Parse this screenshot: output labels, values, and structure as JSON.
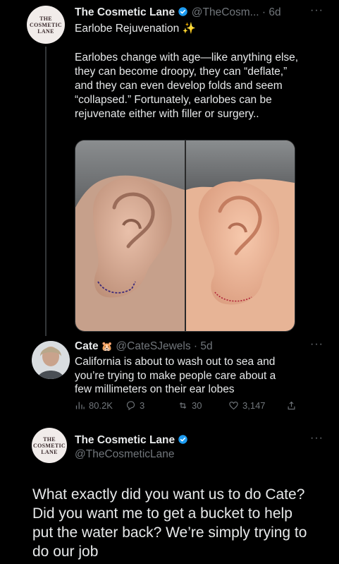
{
  "logo_text": [
    "THE",
    "COSMETIC",
    "LANE"
  ],
  "tweet1": {
    "author_name": "The Cosmetic Lane",
    "handle_time": "@TheCosm... · 6d",
    "headline": "Earlobe Rejuvenation ✨",
    "body": "Earlobes change with age—like anything else, they can become droopy, they can “deflate,” and they can even develop folds and seem “collapsed.” Fortunately, earlobes can be rejuvenate either with filler or surgery.."
  },
  "tweet2": {
    "author_name": "Cate",
    "emoji": "🐹",
    "handle_time": "@CateSJewels · 5d",
    "body": "California is about to wash out to sea and you’re trying to make people care about a few millimeters on their ear lobes",
    "views": "80.2K",
    "replies": "3",
    "retweets": "30",
    "likes": "3,147"
  },
  "tweet3": {
    "author_name": "The Cosmetic Lane",
    "handle": "@TheCosmeticLane",
    "body": "What exactly did you want us to do Cate? Did you want me to get a bucket to help put the water back? We’re simply trying to do our job"
  },
  "colors": {
    "background": "#000000",
    "text": "#e7e9ea",
    "muted": "#71767b",
    "verified": "#1d9bf0"
  },
  "icons": [
    "verified-icon",
    "more-icon",
    "views-icon",
    "reply-icon",
    "retweet-icon",
    "like-icon",
    "share-icon"
  ]
}
